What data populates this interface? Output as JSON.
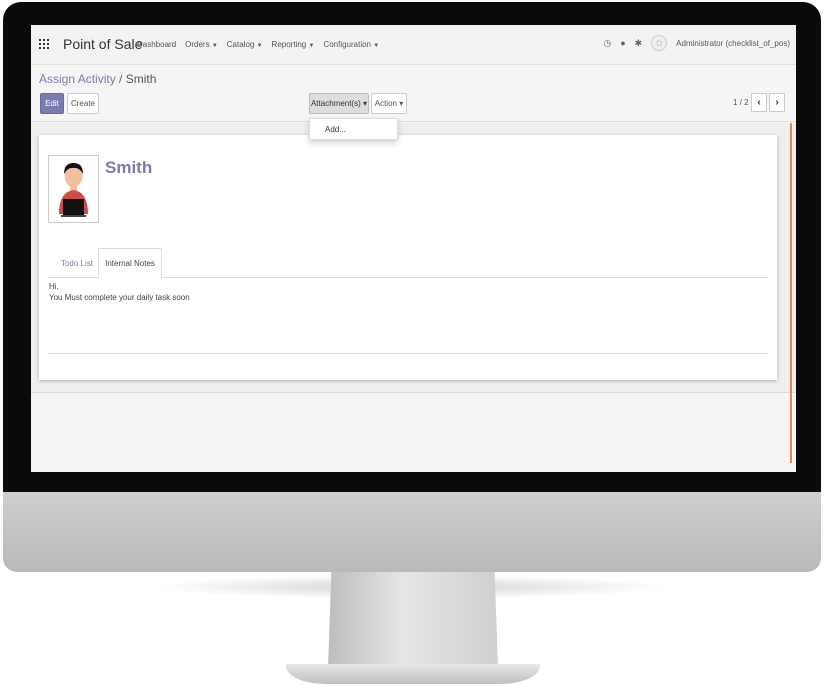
{
  "navbar": {
    "brand": "Point of Sale",
    "menu": [
      {
        "label": "Dashboard",
        "dropdown": false
      },
      {
        "label": "Orders",
        "dropdown": true
      },
      {
        "label": "Catalog",
        "dropdown": true
      },
      {
        "label": "Reporting",
        "dropdown": true
      },
      {
        "label": "Configuration",
        "dropdown": true
      }
    ],
    "user": "Administrator (checklist_of_pos)",
    "icons": [
      "clock-icon",
      "chat-icon",
      "bug-icon"
    ]
  },
  "breadcrumb": {
    "parent": "Assign Activity",
    "separator": "/",
    "current": "Smith"
  },
  "toolbar": {
    "edit_label": "Edit",
    "create_label": "Create",
    "attachments_label": "Attachment(s)",
    "action_label": "Action",
    "caret": "▾",
    "pager": "1 / 2",
    "prev": "‹",
    "next": "›"
  },
  "attachments_menu": {
    "items": [
      "Add..."
    ]
  },
  "record": {
    "name": "Smith",
    "tabs": [
      {
        "label": "Todo List",
        "active": false
      },
      {
        "label": "Internal Notes",
        "active": true
      }
    ],
    "notes": [
      "Hi,",
      "You Must complete your daily task soon"
    ]
  },
  "colors": {
    "accent": "#7c7bad",
    "scroll_accent": "#e08a5a"
  }
}
